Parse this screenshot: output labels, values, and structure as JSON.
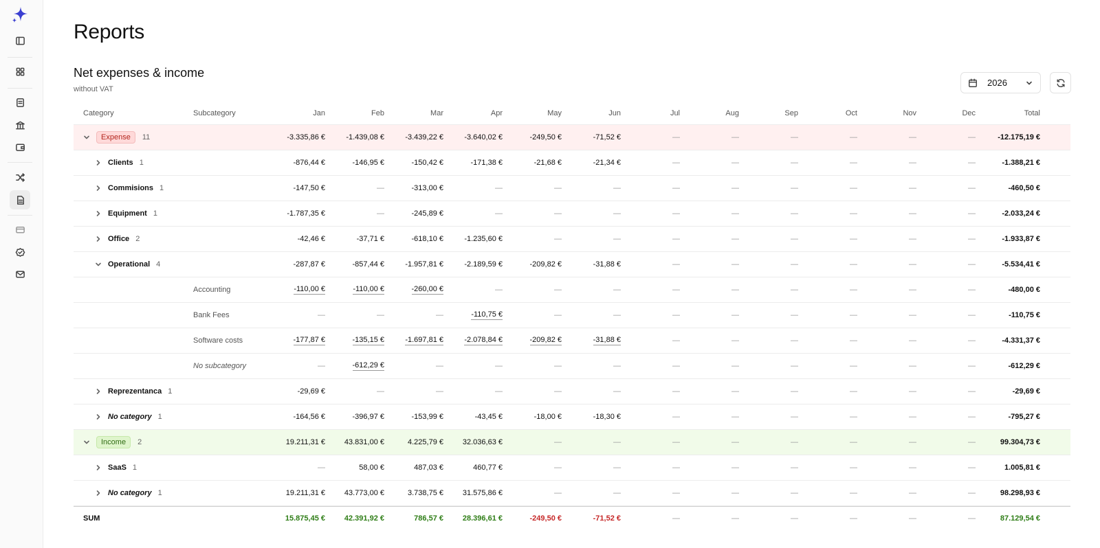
{
  "page": {
    "title": "Reports"
  },
  "section": {
    "title": "Net expenses & income",
    "subtitle": "without VAT"
  },
  "year_filter": {
    "value": "2026"
  },
  "colors": {
    "expense_bg": "#fff0f0",
    "income_bg": "#f1fbe9",
    "positive": "#2e7d16",
    "negative": "#c62828",
    "accent": "#3b3fd1"
  },
  "sidebar": {
    "icons": [
      "sparkle-logo-icon",
      "sidebar-toggle-icon",
      "dashboard-icon",
      "invoice-icon",
      "bank-icon",
      "wallet-icon",
      "shuffle-icon",
      "reports-icon",
      "card-icon",
      "badge-check-icon",
      "mail-icon"
    ]
  },
  "table": {
    "headers": {
      "category": "Category",
      "subcategory": "Subcategory",
      "months": [
        "Jan",
        "Feb",
        "Mar",
        "Apr",
        "May",
        "Jun",
        "Jul",
        "Aug",
        "Sep",
        "Oct",
        "Nov",
        "Dec"
      ],
      "total": "Total"
    },
    "rows": [
      {
        "kind": "group",
        "type": "expense",
        "label": "Expense",
        "count": "11",
        "values": [
          "-3.335,86 €",
          "-1.439,08 €",
          "-3.439,22 €",
          "-3.640,02 €",
          "-249,50 €",
          "-71,52 €",
          "—",
          "—",
          "—",
          "—",
          "—",
          "—"
        ],
        "total": "-12.175,19 €"
      },
      {
        "kind": "category",
        "label": "Clients",
        "count": "1",
        "expanded": false,
        "values": [
          "-876,44 €",
          "-146,95 €",
          "-150,42 €",
          "-171,38 €",
          "-21,68 €",
          "-21,34 €",
          "—",
          "—",
          "—",
          "—",
          "—",
          "—"
        ],
        "total": "-1.388,21 €"
      },
      {
        "kind": "category",
        "label": "Commisions",
        "count": "1",
        "expanded": false,
        "values": [
          "-147,50 €",
          "—",
          "-313,00 €",
          "—",
          "—",
          "—",
          "—",
          "—",
          "—",
          "—",
          "—",
          "—"
        ],
        "total": "-460,50 €"
      },
      {
        "kind": "category",
        "label": "Equipment",
        "count": "1",
        "expanded": false,
        "values": [
          "-1.787,35 €",
          "—",
          "-245,89 €",
          "—",
          "—",
          "—",
          "—",
          "—",
          "—",
          "—",
          "—",
          "—"
        ],
        "total": "-2.033,24 €"
      },
      {
        "kind": "category",
        "label": "Office",
        "count": "2",
        "expanded": false,
        "values": [
          "-42,46 €",
          "-37,71 €",
          "-618,10 €",
          "-1.235,60 €",
          "—",
          "—",
          "—",
          "—",
          "—",
          "—",
          "—",
          "—"
        ],
        "total": "-1.933,87 €"
      },
      {
        "kind": "category",
        "label": "Operational",
        "count": "4",
        "expanded": true,
        "values": [
          "-287,87 €",
          "-857,44 €",
          "-1.957,81 €",
          "-2.189,59 €",
          "-209,82 €",
          "-31,88 €",
          "—",
          "—",
          "—",
          "—",
          "—",
          "—"
        ],
        "total": "-5.534,41 €"
      },
      {
        "kind": "subcategory",
        "label": "Accounting",
        "values": [
          "-110,00 €",
          "-110,00 €",
          "-260,00 €",
          "—",
          "—",
          "—",
          "—",
          "—",
          "—",
          "—",
          "—",
          "—"
        ],
        "total": "-480,00 €"
      },
      {
        "kind": "subcategory",
        "label": "Bank Fees",
        "values": [
          "—",
          "—",
          "—",
          "-110,75 €",
          "—",
          "—",
          "—",
          "—",
          "—",
          "—",
          "—",
          "—"
        ],
        "total": "-110,75 €"
      },
      {
        "kind": "subcategory",
        "label": "Software costs",
        "values": [
          "-177,87 €",
          "-135,15 €",
          "-1.697,81 €",
          "-2.078,84 €",
          "-209,82 €",
          "-31,88 €",
          "—",
          "—",
          "—",
          "—",
          "—",
          "—"
        ],
        "total": "-4.331,37 €"
      },
      {
        "kind": "subcategory",
        "label": "No subcategory",
        "italic": true,
        "values": [
          "—",
          "-612,29 €",
          "—",
          "—",
          "—",
          "—",
          "—",
          "—",
          "—",
          "—",
          "—",
          "—"
        ],
        "total": "-612,29 €"
      },
      {
        "kind": "category",
        "label": "Reprezentanca",
        "count": "1",
        "expanded": false,
        "values": [
          "-29,69 €",
          "—",
          "—",
          "—",
          "—",
          "—",
          "—",
          "—",
          "—",
          "—",
          "—",
          "—"
        ],
        "total": "-29,69 €"
      },
      {
        "kind": "category",
        "label": "No category",
        "italic": true,
        "count": "1",
        "expanded": false,
        "values": [
          "-164,56 €",
          "-396,97 €",
          "-153,99 €",
          "-43,45 €",
          "-18,00 €",
          "-18,30 €",
          "—",
          "—",
          "—",
          "—",
          "—",
          "—"
        ],
        "total": "-795,27 €"
      },
      {
        "kind": "group",
        "type": "income",
        "label": "Income",
        "count": "2",
        "values": [
          "19.211,31 €",
          "43.831,00 €",
          "4.225,79 €",
          "32.036,63 €",
          "—",
          "—",
          "—",
          "—",
          "—",
          "—",
          "—",
          "—"
        ],
        "total": "99.304,73 €"
      },
      {
        "kind": "category",
        "label": "SaaS",
        "count": "1",
        "expanded": false,
        "values": [
          "—",
          "58,00 €",
          "487,03 €",
          "460,77 €",
          "—",
          "—",
          "—",
          "—",
          "—",
          "—",
          "—",
          "—"
        ],
        "total": "1.005,81 €"
      },
      {
        "kind": "category",
        "label": "No category",
        "italic": true,
        "count": "1",
        "expanded": false,
        "values": [
          "19.211,31 €",
          "43.773,00 €",
          "3.738,75 €",
          "31.575,86 €",
          "—",
          "—",
          "—",
          "—",
          "—",
          "—",
          "—",
          "—"
        ],
        "total": "98.298,93 €"
      }
    ],
    "sum": {
      "label": "SUM",
      "values": [
        {
          "v": "15.875,45 €",
          "tone": "positive"
        },
        {
          "v": "42.391,92 €",
          "tone": "positive"
        },
        {
          "v": "786,57 €",
          "tone": "positive"
        },
        {
          "v": "28.396,61 €",
          "tone": "positive"
        },
        {
          "v": "-249,50 €",
          "tone": "negative"
        },
        {
          "v": "-71,52 €",
          "tone": "negative"
        },
        {
          "v": "—",
          "tone": "none"
        },
        {
          "v": "—",
          "tone": "none"
        },
        {
          "v": "—",
          "tone": "none"
        },
        {
          "v": "—",
          "tone": "none"
        },
        {
          "v": "—",
          "tone": "none"
        },
        {
          "v": "—",
          "tone": "none"
        }
      ],
      "total": {
        "v": "87.129,54 €",
        "tone": "positive"
      }
    }
  }
}
